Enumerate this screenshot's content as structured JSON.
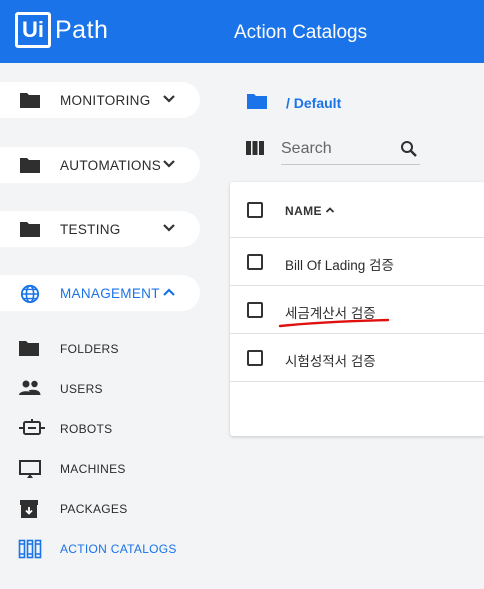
{
  "header": {
    "logo_box": "Ui",
    "logo_text": "Path",
    "title": "Action Catalogs",
    "background": "#1a73e8"
  },
  "sidebar": {
    "groups": [
      {
        "label": "MONITORING",
        "icon": "folder-icon",
        "chevron": "chevron-down-icon"
      },
      {
        "label": "AUTOMATIONS",
        "icon": "folder-icon",
        "chevron": "chevron-down-icon"
      },
      {
        "label": "TESTING",
        "icon": "folder-icon",
        "chevron": "chevron-down-icon"
      },
      {
        "label": "MANAGEMENT",
        "icon": "globe-icon",
        "chevron": "chevron-up-icon",
        "active": true
      }
    ],
    "items": [
      {
        "label": "FOLDERS",
        "icon": "folder-icon"
      },
      {
        "label": "USERS",
        "icon": "people-icon"
      },
      {
        "label": "ROBOTS",
        "icon": "robot-icon"
      },
      {
        "label": "MACHINES",
        "icon": "monitor-icon"
      },
      {
        "label": "PACKAGES",
        "icon": "package-icon"
      },
      {
        "label": "ACTION CATALOGS",
        "icon": "catalog-icon",
        "active": true
      }
    ]
  },
  "main": {
    "breadcrumb": "/ Default",
    "search_placeholder": "Search",
    "table": {
      "column": "NAME",
      "rows": [
        "Bill Of Lading 검증",
        "세금계산서 검증",
        "시험성적서 검증"
      ]
    }
  },
  "colors": {
    "accent": "#1a73e8",
    "annotation": "#e01010"
  }
}
